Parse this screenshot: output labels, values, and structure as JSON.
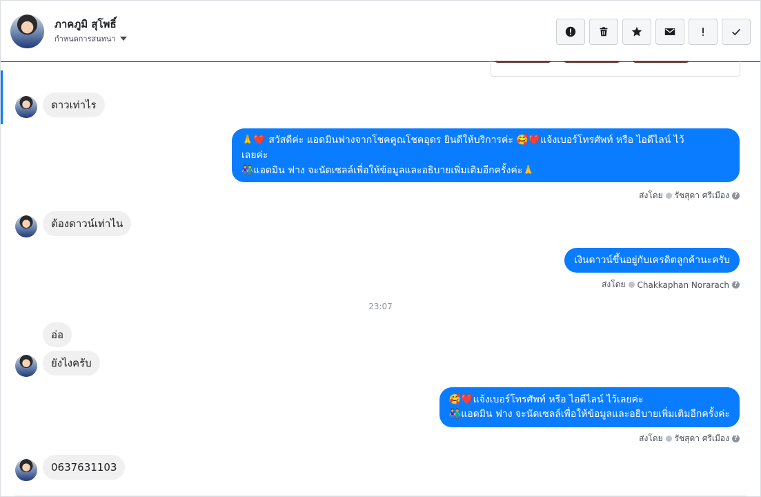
{
  "header": {
    "name": "ภาคภูมิ สุโพธิ์",
    "assign_label": "กำหนดการสนทนา",
    "tools": [
      {
        "icon": "alert-circle-icon",
        "name": "spam-button"
      },
      {
        "icon": "trash-icon",
        "name": "delete-button"
      },
      {
        "icon": "star-icon",
        "name": "star-button"
      },
      {
        "icon": "envelope-icon",
        "name": "mark-unread-button"
      },
      {
        "icon": "exclamation-icon",
        "name": "follow-up-button"
      },
      {
        "icon": "check-icon",
        "name": "done-button"
      }
    ]
  },
  "messages": {
    "m1": "ดาวเท่าไร",
    "m2_line1": "🙏❤️ สวัสดีค่ะ แอดมินฟางจากโชคคูณโชคอุดร ยินดีให้บริการค่ะ 🥰❤️แจ้งเบอร์โทรศัพท์ หรือ ไอดีไลน์  ไว้",
    "m2_line2": "เลยค่ะ",
    "m2_line3": "👫แอดมิน ฟาง จะนัดเซลล์เพื่อให้ข้อมูลและอธิบายเพิ่มเติมอีกครั้งค่ะ🙏",
    "m2_sent_prefix": "ส่งโดย",
    "m2_sent_by": "รัชสุดา ศรีเมือง",
    "m3": "ต้องดาวน์เท่าไน",
    "m4": "เงินดาวน์ขึ้นอยู่กับเครดิตลูกค้านะครับ",
    "m4_sent_prefix": "ส่งโดย",
    "m4_sent_by": "Chakkaphan Norarach",
    "timestamp": "23:07",
    "m5": "อ่อ",
    "m6": "ยังไงครับ",
    "m7_line1": "🥰❤️แจ้งเบอร์โทรศัพท์ หรือ ไอดีไลน์  ไว้เลยค่ะ",
    "m7_line2": "👫แอดมิน ฟาง จะนัดเซลล์เพื่อให้ข้อมูลและอธิบายเพิ่มเติมอีกครั้งค่ะ",
    "m7_sent_prefix": "ส่งโดย",
    "m7_sent_by": "รัชสุดา ศรีเมือง",
    "m8": "0637631103"
  },
  "help_glyph": "?",
  "colors": {
    "outgoing": "#0a7cff",
    "incoming": "#f0f0f0",
    "accent_bar": "#0a7cff"
  }
}
